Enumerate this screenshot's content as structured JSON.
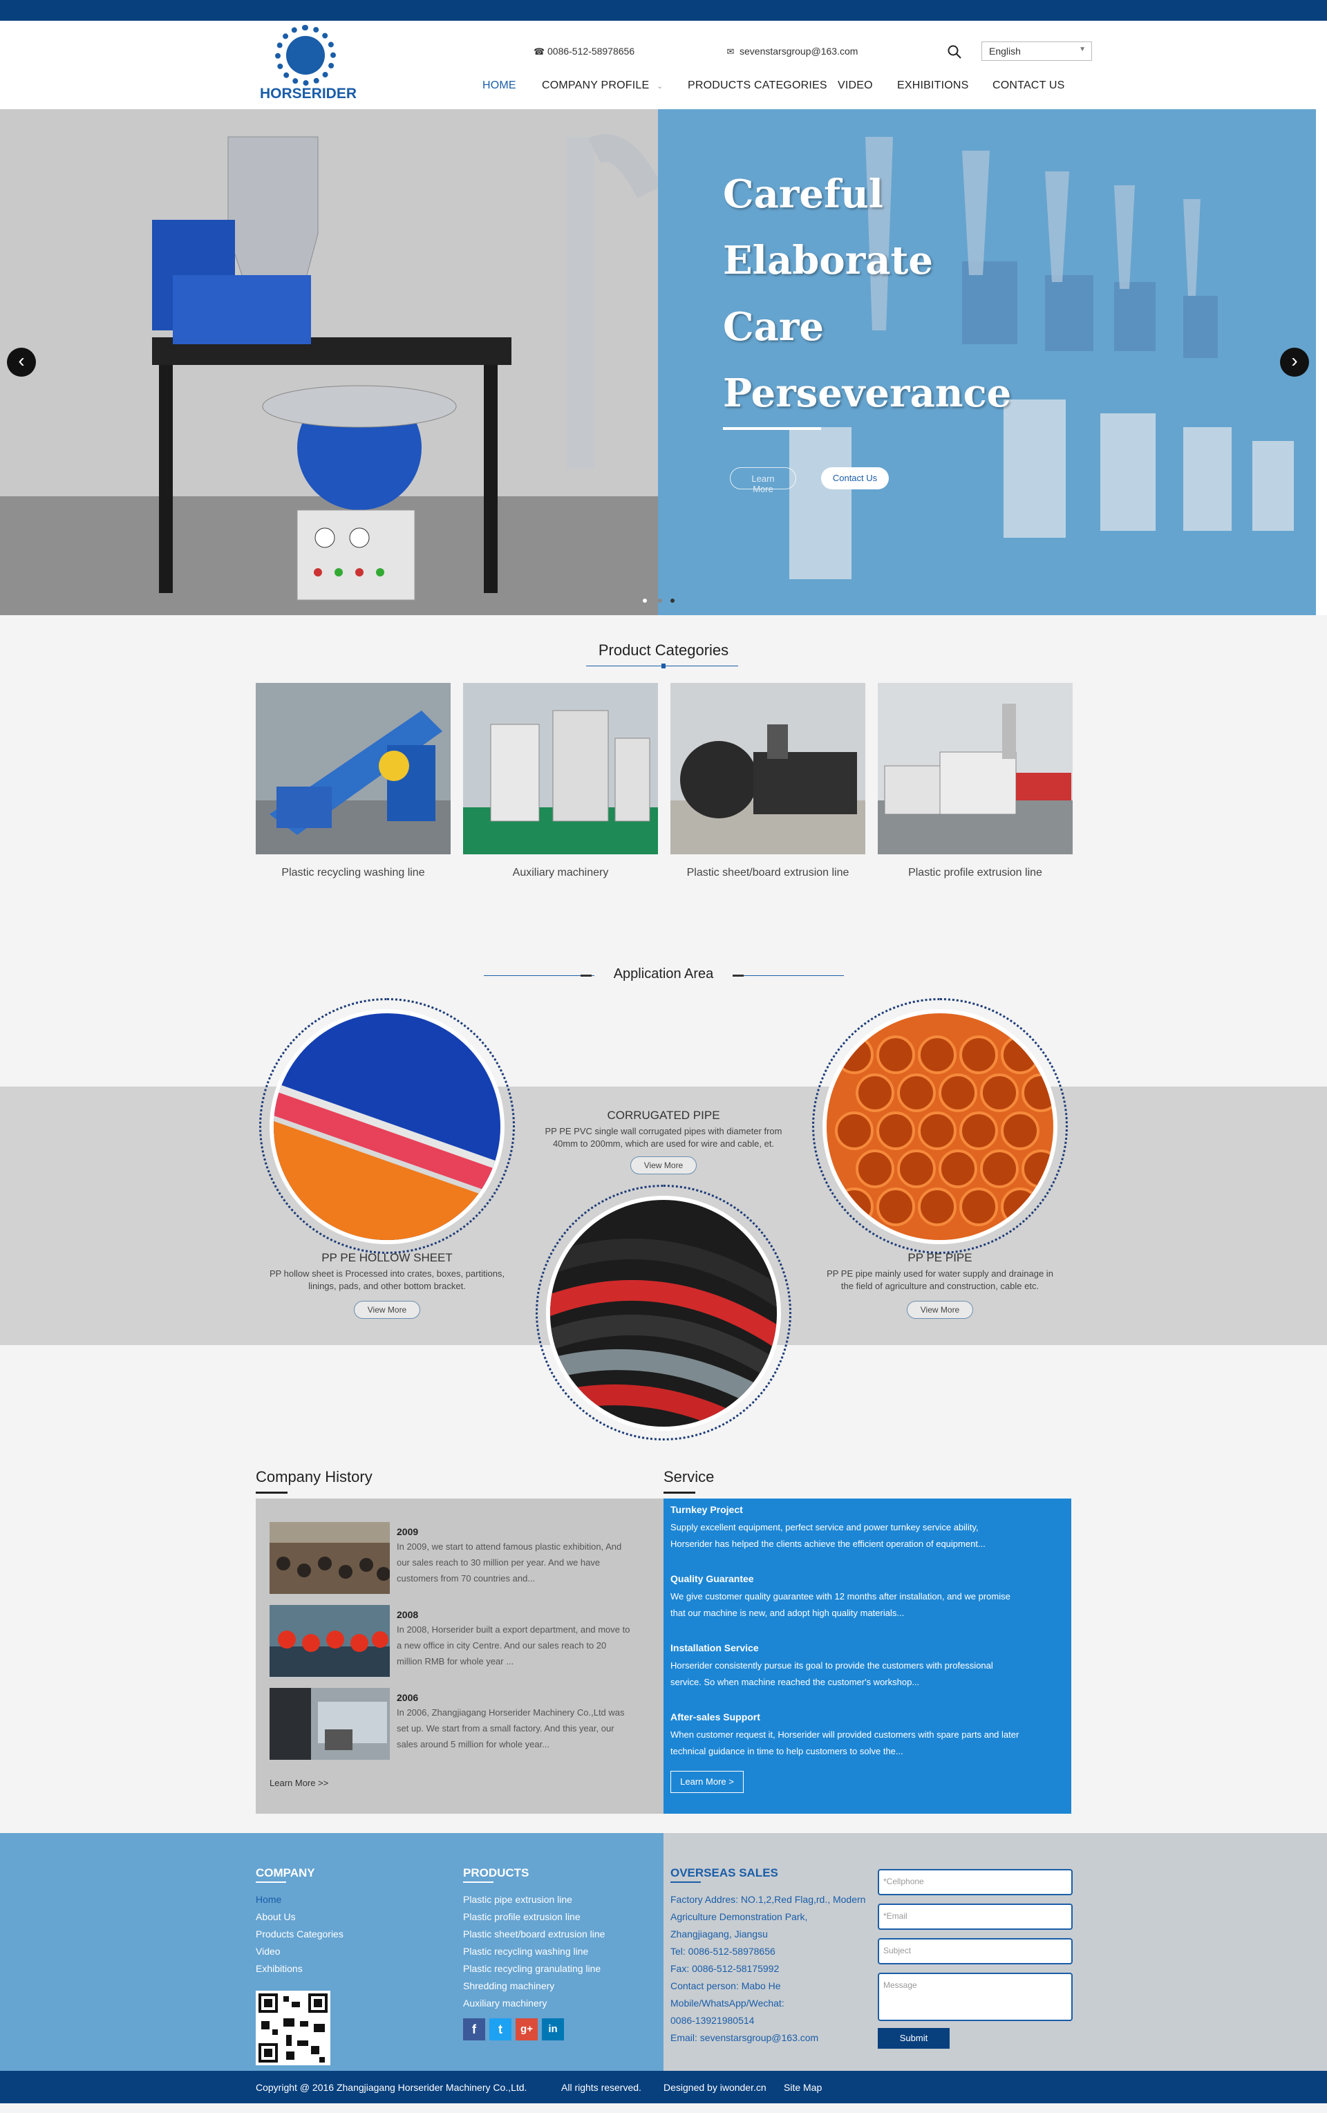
{
  "brand": {
    "logo_text": "HORSERIDER"
  },
  "header": {
    "phone": "0086-512-58978656",
    "email": "sevenstarsgroup@163.com",
    "language": "English"
  },
  "nav": [
    "HOME",
    "COMPANY PROFILE",
    "PRODUCTS CATEGORIES",
    "VIDEO",
    "EXHIBITIONS",
    "CONTACT US"
  ],
  "hero": {
    "slogans": [
      "Careful",
      "Elaborate",
      "Care",
      "Perseverance"
    ],
    "learn_more": "Learn More",
    "contact_us": "Contact Us"
  },
  "categories": {
    "title": "Product Categories",
    "items": [
      "Plastic recycling washing line",
      "Auxiliary machinery",
      "Plastic sheet/board extrusion line",
      "Plastic profile extrusion line"
    ]
  },
  "application": {
    "title": "Application Area",
    "view_more": "View More",
    "hollow": {
      "title": "PP PE HOLLOW SHEET",
      "desc1": "PP hollow sheet is Processed into crates, boxes, partitions,",
      "desc2": "linings, pads, and other bottom bracket."
    },
    "corrugated": {
      "title": "CORRUGATED PIPE",
      "desc1": "PP PE PVC single wall corrugated pipes with diameter from",
      "desc2": "40mm to 200mm, which are used for wire and cable, et."
    },
    "pipe": {
      "title": "PP PE PIPE",
      "desc1": "PP PE pipe mainly used for water supply and drainage in",
      "desc2": "the field of agriculture and construction, cable etc."
    }
  },
  "history": {
    "title": "Company History",
    "learn_more": "Learn More >>",
    "entries": [
      {
        "year": "2009",
        "l1": "In 2009, we start to attend famous plastic exhibition, And",
        "l2": "our sales reach to 30 million per year. And we have",
        "l3": "customers from 70 countries and..."
      },
      {
        "year": "2008",
        "l1": "In 2008, Horserider built a export department, and move to",
        "l2": "a new office in city Centre. And our sales reach to 20",
        "l3": "million RMB for whole year ..."
      },
      {
        "year": "2006",
        "l1": "In 2006, Zhangjiagang Horserider Machinery Co.,Ltd  was",
        "l2": "set up. We start from a small factory. And this year, our",
        "l3": "sales around 5 million for whole year..."
      }
    ]
  },
  "service": {
    "title": "Service",
    "learn_more": "Learn More >",
    "items": [
      {
        "head": "Turnkey Project",
        "l1": "Supply excellent equipment, perfect service and power turnkey service ability,",
        "l2": "Horserider has helped the clients achieve the efficient operation of equipment..."
      },
      {
        "head": "Quality Guarantee",
        "l1": "We give customer quality guarantee with 12 months after installation, and we promise",
        "l2": "that our machine is new, and adopt high quality materials..."
      },
      {
        "head": "Installation Service",
        "l1": "Horserider consistently pursue its goal to provide the customers with professional",
        "l2": "service. So when machine reached the customer's workshop..."
      },
      {
        "head": "After-sales Support",
        "l1": "When customer request it, Horserider will provided customers with spare parts and later",
        "l2": "technical guidance in time to help customers to solve the..."
      }
    ]
  },
  "footer": {
    "company_title": "COMPANY",
    "company_links": [
      "Home",
      "About Us",
      "Products Categories",
      "Video",
      "Exhibitions"
    ],
    "products_title": "PRODUCTS",
    "product_links": [
      "Plastic pipe extrusion line",
      "Plastic profile extrusion line",
      "Plastic sheet/board extrusion line",
      "Plastic recycling washing line",
      "Plastic recycling granulating line",
      "Shredding machinery",
      "Auxiliary machinery"
    ],
    "overseas_title": "OVERSEAS SALES",
    "overseas": [
      "Factory Addres: NO.1,2,Red Flag,rd., Modern",
      "Agriculture Demonstration Park,",
      "Zhangjiagang, Jiangsu",
      "Tel: 0086-512-58978656",
      "Fax: 0086-512-58175992",
      "Contact person: Mabo He",
      "Mobile/WhatsApp/Wechat:",
      "0086-13921980514",
      "Email: sevenstarsgroup@163.com"
    ],
    "form": {
      "cellphone": "*Cellphone",
      "email": "*Email",
      "subject": "Subject",
      "message": "Message",
      "submit": "Submit"
    },
    "social": [
      "f",
      "t",
      "g+",
      "in"
    ]
  },
  "copyright": {
    "text": "Copyright @ 2016 Zhangjiagang Horserider Machinery Co.,Ltd.",
    "rights": "All rights reserved.",
    "designed": "Designed by iwonder.cn",
    "sitemap": "Site Map"
  },
  "colors": {
    "primary": "#08407e",
    "accent": "#1a5da8",
    "service_bg": "#1d86d4",
    "hero_blue": "#65a4cf"
  }
}
